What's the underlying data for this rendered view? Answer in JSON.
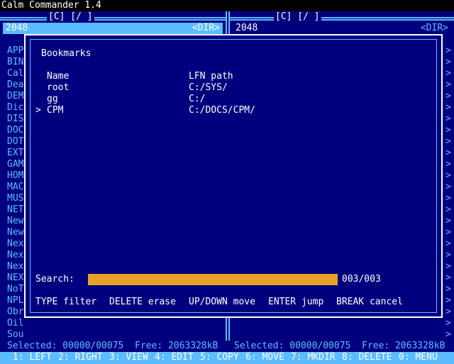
{
  "app": {
    "title": "Calm Commander 1.4"
  },
  "left_panel": {
    "path": "[C] [/                ]",
    "header_name": "2048",
    "header_type": "<DIR>",
    "files": [
      "APP",
      "BIN",
      "Cal",
      "Dea",
      "DEM",
      "Dic",
      "DIS",
      "DOC",
      "DOT",
      "EXT",
      "GAM",
      "HOM",
      "MAC",
      "MUS",
      "NET",
      "New",
      "New",
      "Nex",
      "Nex",
      "Nex",
      "NEX",
      "NoT",
      "NPL",
      "Obr",
      "Oil",
      "Sou"
    ]
  },
  "right_panel": {
    "path": "[C] [/                ]",
    "header_name": "2048",
    "header_type": "<DIR>",
    "chevrons": [
      ">",
      ">",
      ">",
      ">",
      ">",
      ">",
      ">",
      ">",
      ">",
      ">",
      ">",
      ">",
      ">",
      ">",
      ">",
      ">",
      ">",
      ">",
      ">",
      ">",
      ">",
      ">",
      ">",
      ">",
      ">",
      ">"
    ]
  },
  "dialog": {
    "title": "Bookmarks",
    "col_name": "Name",
    "col_path": "LFN path",
    "bookmarks": [
      {
        "marker": " ",
        "name": "root",
        "path": "C:/SYS/"
      },
      {
        "marker": " ",
        "name": "gg",
        "path": "C:/"
      },
      {
        "marker": ">",
        "name": "CPM",
        "path": "C:/DOCS/CPM/"
      }
    ],
    "search_label": "Search:",
    "search_value": "",
    "counter": "003/003",
    "hints": [
      "TYPE filter",
      "DELETE erase",
      "UP/DOWN move",
      "ENTER jump",
      "BREAK cancel"
    ]
  },
  "status": {
    "left": "Selected: 00000/00075  Free: 2063328kB",
    "right": "Selected: 00000/00075  Free: 2063328kB"
  },
  "function_keys": [
    {
      "num": "1:",
      "label": "LEFT"
    },
    {
      "num": "2:",
      "label": "RIGHT"
    },
    {
      "num": "3:",
      "label": "VIEW"
    },
    {
      "num": "4:",
      "label": "EDIT"
    },
    {
      "num": "5:",
      "label": "COPY"
    },
    {
      "num": "6:",
      "label": "MOVE"
    },
    {
      "num": "7:",
      "label": "MKDIR"
    },
    {
      "num": "8:",
      "label": "DELETE"
    },
    {
      "num": "0:",
      "label": "MENU"
    }
  ],
  "colors": {
    "background": "#00007f",
    "accent": "#5cbcff",
    "search_bar": "#e8a22a",
    "text": "#ffffff"
  }
}
